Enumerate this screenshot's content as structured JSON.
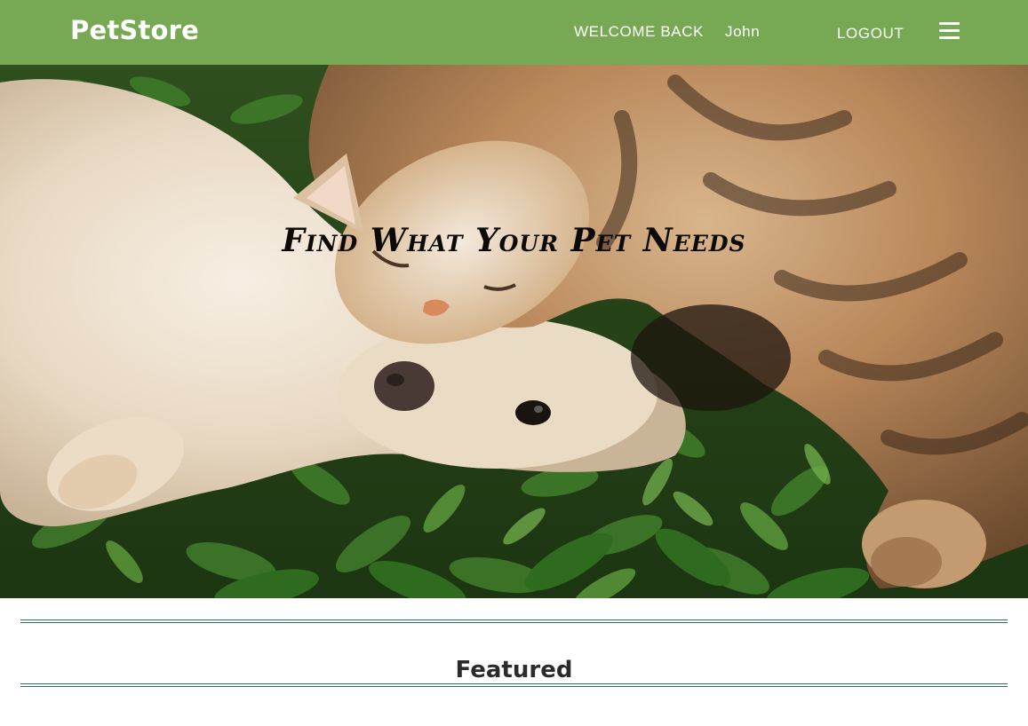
{
  "header": {
    "brand": "PetStore",
    "welcome_label": "WELCOME BACK",
    "username": "John",
    "logout_label": "LOGOUT",
    "menu_icon": "hamburger-menu-icon"
  },
  "hero": {
    "headline": "Find What Your Pet Needs",
    "image": "dog-and-cat-lying-in-grass-photo"
  },
  "featured": {
    "title": "Featured"
  },
  "colors": {
    "navbar": "#77a853",
    "nav_text": "#ffffff",
    "rule": "#2e6d6a",
    "heading_text": "#2b2b2b"
  }
}
